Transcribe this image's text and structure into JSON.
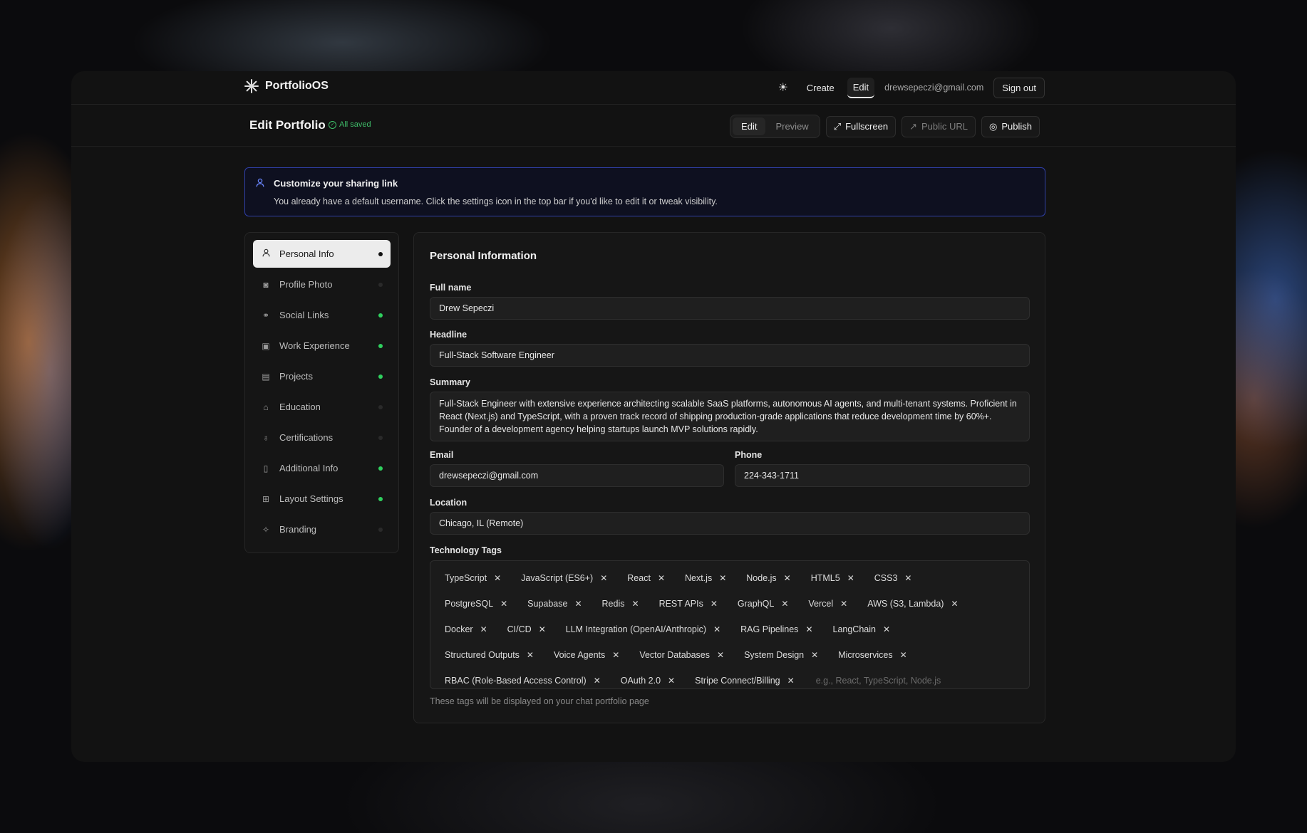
{
  "brand": {
    "name": "PortfolioOS",
    "icon": "sparkle-logo-icon"
  },
  "nav": {
    "theme_icon": "sun-icon",
    "create": "Create",
    "edit": "Edit",
    "user_email": "drewsepeczi@gmail.com",
    "sign_out": "Sign out"
  },
  "subbar": {
    "title": "Edit Portfolio",
    "saved_status": "All saved",
    "mode_edit": "Edit",
    "mode_preview": "Preview",
    "fullscreen": "Fullscreen",
    "public_url": "Public URL",
    "publish": "Publish"
  },
  "banner": {
    "title": "Customize your sharing link",
    "text": "You already have a default username. Click the settings icon in the top bar if you'd like to edit it or tweak visibility."
  },
  "sidebar": {
    "items": [
      {
        "label": "Personal Info",
        "icon": "user-icon",
        "status": "active"
      },
      {
        "label": "Profile Photo",
        "icon": "camera-icon",
        "status": "empty"
      },
      {
        "label": "Social Links",
        "icon": "link-icon",
        "status": "complete"
      },
      {
        "label": "Work Experience",
        "icon": "briefcase-icon",
        "status": "complete"
      },
      {
        "label": "Projects",
        "icon": "folder-icon",
        "status": "complete"
      },
      {
        "label": "Education",
        "icon": "graduation-cap-icon",
        "status": "empty"
      },
      {
        "label": "Certifications",
        "icon": "award-icon",
        "status": "empty"
      },
      {
        "label": "Additional Info",
        "icon": "document-icon",
        "status": "complete"
      },
      {
        "label": "Layout Settings",
        "icon": "layout-icon",
        "status": "complete"
      },
      {
        "label": "Branding",
        "icon": "sparkles-icon",
        "status": "empty"
      }
    ]
  },
  "form": {
    "section_title": "Personal Information",
    "full_name_label": "Full name",
    "full_name_value": "Drew Sepeczi",
    "headline_label": "Headline",
    "headline_value": "Full-Stack Software Engineer",
    "summary_label": "Summary",
    "summary_value": "Full-Stack Engineer with extensive experience architecting scalable SaaS platforms, autonomous AI agents, and multi-tenant systems. Proficient in React (Next.js) and TypeScript, with a proven track record of shipping production-grade applications that reduce development time by 60%+. Founder of a development agency helping startups launch MVP solutions rapidly.",
    "email_label": "Email",
    "email_value": "drewsepeczi@gmail.com",
    "phone_label": "Phone",
    "phone_value": "224-343-1711",
    "location_label": "Location",
    "location_value": "Chicago, IL (Remote)",
    "tags_label": "Technology Tags",
    "tags_placeholder": "e.g., React, TypeScript, Node.js",
    "tags_hint": "These tags will be displayed on your chat portfolio page",
    "tag_rows": [
      [
        "TypeScript",
        "JavaScript (ES6+)",
        "React",
        "Next.js",
        "Node.js",
        "HTML5",
        "CSS3"
      ],
      [
        "PostgreSQL",
        "Supabase",
        "Redis",
        "REST APIs",
        "GraphQL",
        "Vercel",
        "AWS (S3, Lambda)"
      ],
      [
        "Docker",
        "CI/CD",
        "LLM Integration (OpenAI/Anthropic)",
        "RAG Pipelines",
        "LangChain"
      ],
      [
        "Structured Outputs",
        "Voice Agents",
        "Vector Databases",
        "System Design",
        "Microservices"
      ],
      [
        "RBAC (Role-Based Access Control)",
        "OAuth 2.0",
        "Stripe Connect/Billing"
      ]
    ]
  },
  "colors": {
    "accent_green": "#2fd05e",
    "banner_border": "#2f3fa8",
    "banner_icon": "#6a86ff"
  }
}
